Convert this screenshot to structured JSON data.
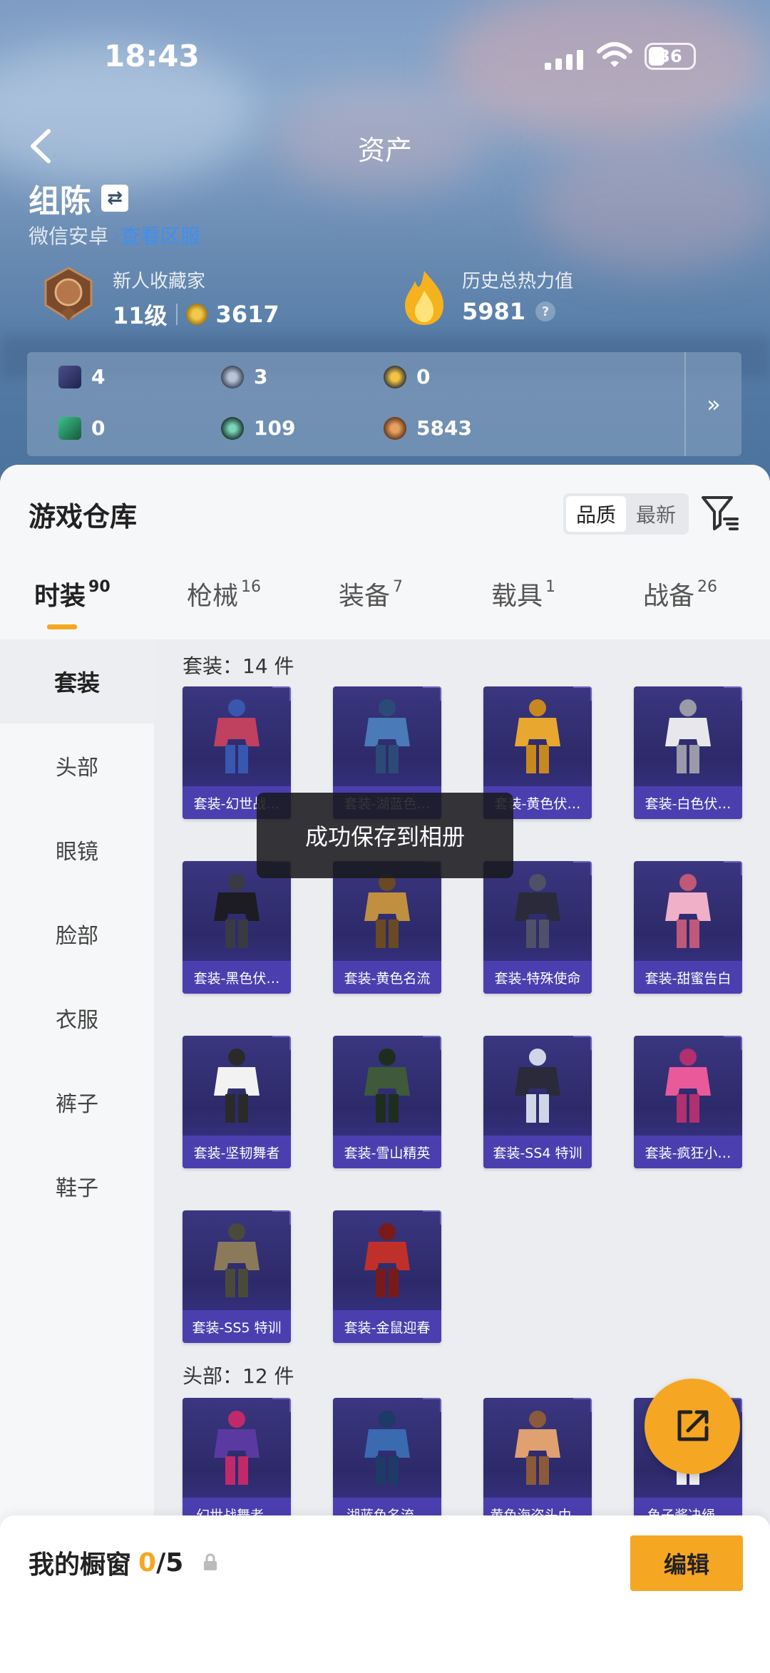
{
  "status_bar": {
    "time": "18:43",
    "battery": "36"
  },
  "nav": {
    "title": "资产"
  },
  "profile": {
    "name": "组陈",
    "platform": "微信安卓",
    "platform_link": "·查看区服",
    "rank_title": "新人收藏家",
    "level": "11级",
    "points": "3617",
    "heat_label": "历史总热力值",
    "heat_value": "5981",
    "help_mark": "?"
  },
  "stats": [
    {
      "icon": "card-icon",
      "value": "4"
    },
    {
      "icon": "medal-icon",
      "value": "3"
    },
    {
      "icon": "gold-badge-icon",
      "value": "0"
    },
    {
      "icon": "green-card-icon",
      "value": "0"
    },
    {
      "icon": "orb-icon",
      "value": "109"
    },
    {
      "icon": "bronze-coin-icon",
      "value": "5843"
    }
  ],
  "stats_more": "»",
  "warehouse": {
    "title": "游戏仓库",
    "sort_options": [
      "品质",
      "最新"
    ],
    "sort_selected": "品质"
  },
  "tabs": [
    {
      "label": "时装",
      "count": "90"
    },
    {
      "label": "枪械",
      "count": "16"
    },
    {
      "label": "装备",
      "count": "7"
    },
    {
      "label": "载具",
      "count": "1"
    },
    {
      "label": "战备",
      "count": "26"
    }
  ],
  "active_tab": "时装",
  "sidebar": [
    "套装",
    "头部",
    "眼镜",
    "脸部",
    "衣服",
    "裤子",
    "鞋子"
  ],
  "sections": [
    {
      "label": "套装：14 件",
      "items": [
        "套装-幻世战…",
        "套装-湖蓝色…",
        "套装-黄色伏…",
        "套装-白色伏…",
        "套装-黑色伏…",
        "套装-黄色名流",
        "套装-特殊使命",
        "套装-甜蜜告白",
        "套装-坚韧舞者",
        "套装-雪山精英",
        "套装-SS4 特训",
        "套装-疯狂小…",
        "套装-SS5 特训",
        "套装-金鼠迎春"
      ]
    },
    {
      "label": "头部：12 件",
      "items": [
        "幻世战舞者…",
        "湖蓝色名流…",
        "黄色海盗头巾…",
        "鱼子酱决绳…"
      ]
    }
  ],
  "toast": "成功保存到相册",
  "showcase": {
    "label": "我的橱窗",
    "current": "0",
    "total": "/5"
  },
  "edit_button": "编辑",
  "colors": {
    "accent": "#f5a623",
    "card_bg": "#2d2a6a",
    "card_label": "#4b3fb0",
    "link": "#3f8ff0"
  }
}
